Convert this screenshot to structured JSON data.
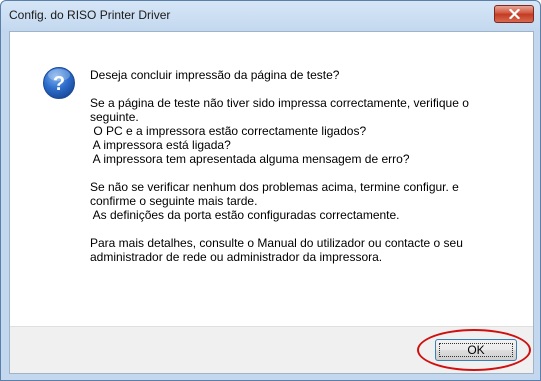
{
  "window": {
    "title": "Config. do RISO Printer Driver"
  },
  "message": {
    "question": "Deseja concluir impressão da página de teste?",
    "check_intro_1": "Se a página de teste não tiver sido impressa correctamente, verifique o",
    "check_intro_2": "seguinte.",
    "check_item_1": " O PC e a impressora estão correctamente ligados?",
    "check_item_2": " A impressora está ligada?",
    "check_item_3": " A impressora tem apresentada alguma mensagem de erro?",
    "problems_1": "Se não se verificar nenhum dos problemas acima, termine configur. e",
    "problems_2": "confirme o seguinte mais tarde.",
    "problems_item": " As definições da porta estão configuradas correctamente.",
    "details_1": "Para mais detalhes, consulte o Manual do utilizador ou contacte o seu",
    "details_2": "administrador de rede ou administrador da impressora."
  },
  "buttons": {
    "ok_label": "OK"
  },
  "icons": {
    "dialog_icon": "question-icon",
    "close_icon": "close-icon"
  },
  "colors": {
    "annotation_ellipse": "#d01010",
    "close_button": "#c23a22"
  }
}
